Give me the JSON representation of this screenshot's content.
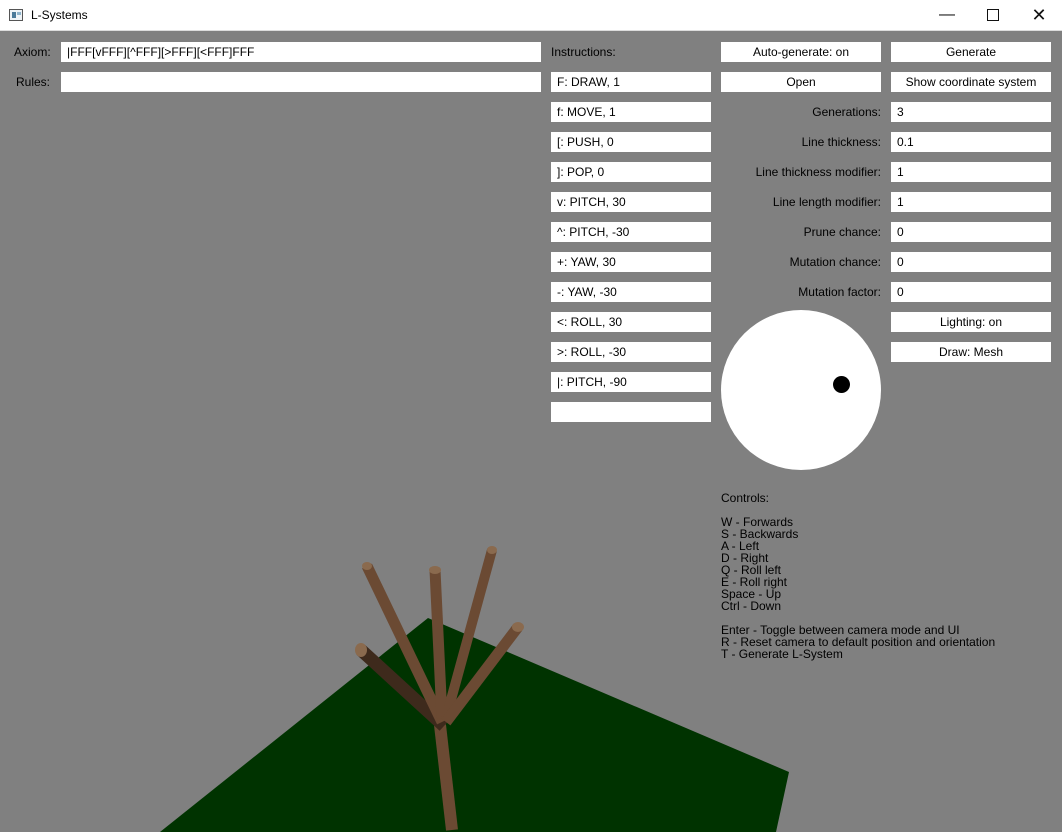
{
  "window": {
    "title": "L-Systems",
    "minimize": "—",
    "close": "✕"
  },
  "axiom": {
    "label": "Axiom:",
    "value": "|FFF[vFFF][^FFF][>FFF][<FFF]FFF"
  },
  "rules": {
    "label": "Rules:",
    "value": ""
  },
  "instructions": {
    "label": "Instructions:",
    "items": [
      "F: DRAW, 1",
      "f: MOVE, 1",
      "[: PUSH, 0",
      "]: POP, 0",
      "v: PITCH, 30",
      "^: PITCH, -30",
      "+: YAW, 30",
      "-: YAW, -30",
      "<: ROLL, 30",
      ">: ROLL, -30",
      "|: PITCH, -90",
      ""
    ]
  },
  "buttons": {
    "auto_generate": "Auto-generate: on",
    "generate": "Generate",
    "open": "Open",
    "show_coords": "Show coordinate system",
    "lighting": "Lighting: on",
    "draw_mode": "Draw: Mesh"
  },
  "settings": [
    {
      "label": "Generations:",
      "value": "3"
    },
    {
      "label": "Line thickness:",
      "value": "0.1"
    },
    {
      "label": "Line thickness modifier:",
      "value": "1"
    },
    {
      "label": "Line length modifier:",
      "value": "1"
    },
    {
      "label": "Prune chance:",
      "value": "0"
    },
    {
      "label": "Mutation chance:",
      "value": "0"
    },
    {
      "label": "Mutation factor:",
      "value": "0"
    }
  ],
  "controls": {
    "title": "Controls:",
    "movement": [
      "W - Forwards",
      "S - Backwards",
      "A - Left",
      "D - Right",
      "Q - Roll left",
      "E - Roll right",
      "Space - Up",
      "Ctrl - Down"
    ],
    "other": [
      "Enter - Toggle between camera mode and UI",
      "R - Reset camera to default position and orientation",
      "T - Generate L-System"
    ]
  },
  "colors": {
    "background": "#808080",
    "ground": "#003300",
    "branch": "#6b4a33",
    "branch_shadow": "#3e2a1c",
    "branch_cap": "#8a6a4e"
  }
}
